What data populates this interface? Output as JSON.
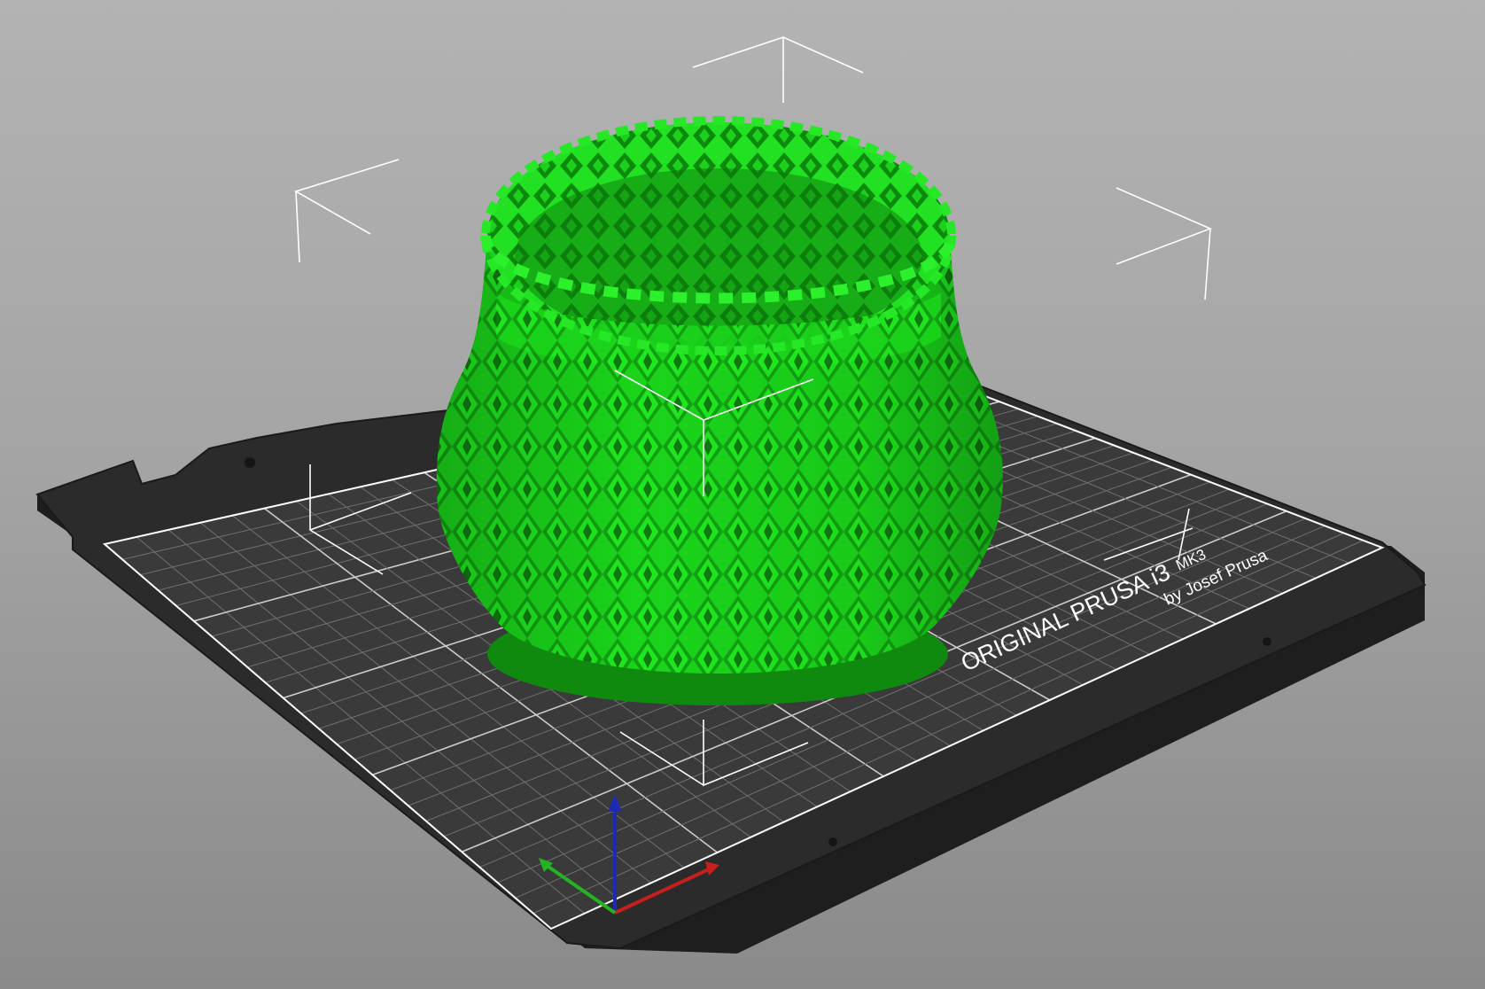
{
  "viewport": {
    "name": "3D scene view",
    "background_top": "#b3b3b3",
    "background_bottom": "#8a8a8a"
  },
  "bed": {
    "brand_text": "ORIGINAL PRUSA i3",
    "model_text": "MK3",
    "byline_text": "by Josef Prusa",
    "sheet_color": "#3a3a3a",
    "frame_color": "#262626",
    "grid_color": "#ffffff"
  },
  "object": {
    "name": "lattice vase",
    "color": "#1ee01e",
    "shade_color": "#119611",
    "state": "selected"
  },
  "axes": {
    "x_color": "#c81e1e",
    "y_color": "#22b422",
    "z_color": "#1e2ab4"
  },
  "selection_box": {
    "line_color": "#ffffff"
  }
}
